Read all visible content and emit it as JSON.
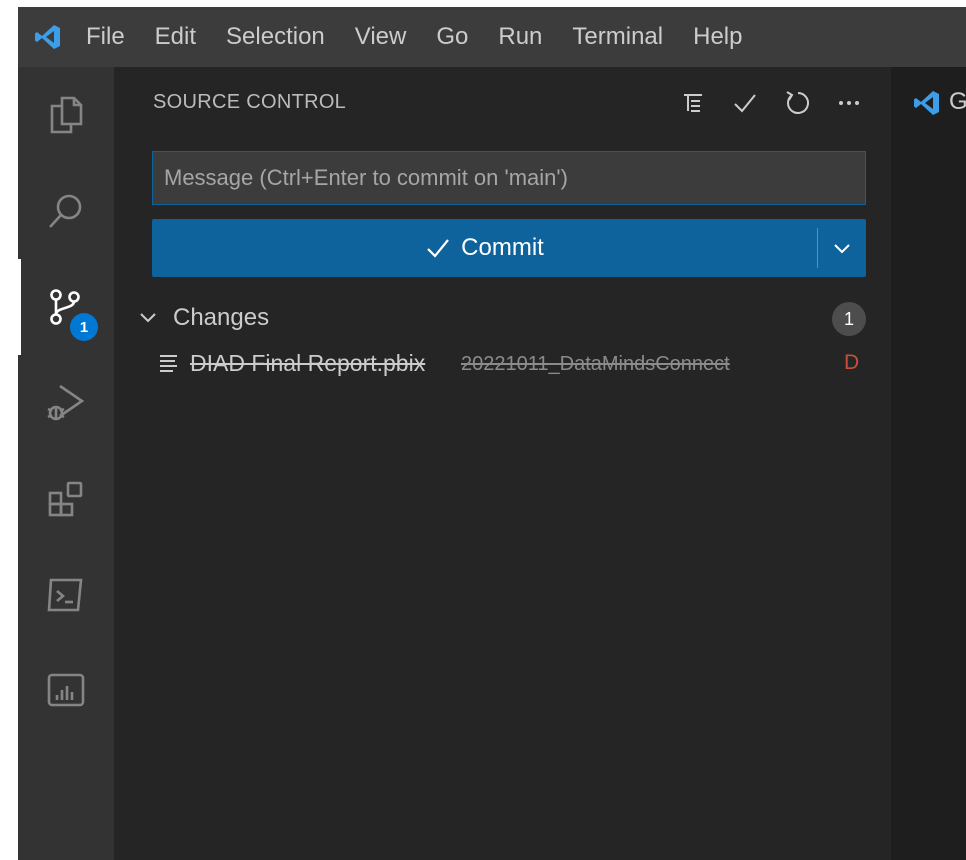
{
  "menu": {
    "items": [
      "File",
      "Edit",
      "Selection",
      "View",
      "Go",
      "Run",
      "Terminal",
      "Help"
    ]
  },
  "activity_bar": {
    "items": [
      {
        "name": "explorer-icon"
      },
      {
        "name": "search-icon"
      },
      {
        "name": "source-control-icon",
        "badge": "1",
        "active": true
      },
      {
        "name": "run-debug-icon"
      },
      {
        "name": "extensions-icon"
      },
      {
        "name": "terminal-icon"
      },
      {
        "name": "power-bi-icon"
      }
    ]
  },
  "sidebar": {
    "title": "SOURCE CONTROL",
    "actions": [
      "view-as-tree-icon",
      "commit-check-icon",
      "refresh-icon",
      "more-actions-icon"
    ],
    "message_placeholder": "Message (Ctrl+Enter to commit on 'main')",
    "message_value": "",
    "commit_label": "Commit",
    "changes": {
      "label": "Changes",
      "count": "1",
      "files": [
        {
          "name": "DIAD Final Report.pbix",
          "description": "20221011_DataMindsConnect",
          "status": "D"
        }
      ]
    }
  },
  "editor": {
    "tab_label": "G"
  },
  "colors": {
    "accent": "#0e639c",
    "badge": "#0078d4",
    "deleted": "#c74e39",
    "vscode_logo": "#3c9ee8"
  }
}
